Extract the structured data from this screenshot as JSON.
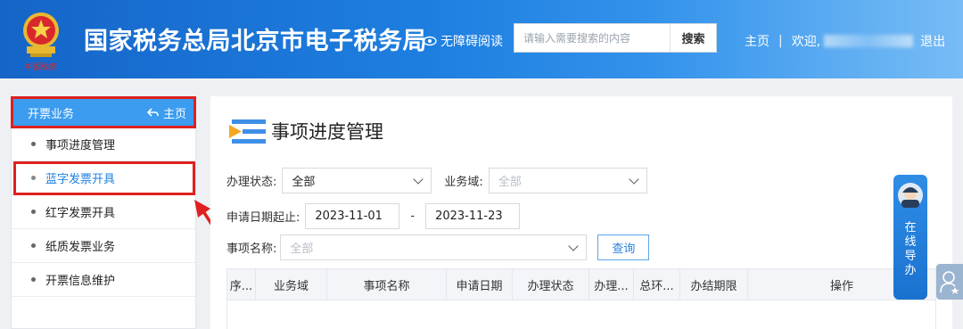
{
  "header": {
    "site_title": "国家税务总局北京市电子税务局",
    "accessible_reading": "无障碍阅读",
    "search_placeholder": "请输入需要搜索的内容",
    "search_button": "搜索",
    "home_link": "主页",
    "separator": "|",
    "welcome": "欢迎,",
    "logout": "退出"
  },
  "sidebar": {
    "section_title": "开票业务",
    "home_label": "主页",
    "items": [
      {
        "label": "事项进度管理"
      },
      {
        "label": "蓝字发票开具"
      },
      {
        "label": "红字发票开具"
      },
      {
        "label": "纸质发票业务"
      },
      {
        "label": "开票信息维护"
      }
    ],
    "active_index": 1
  },
  "main": {
    "page_title": "事项进度管理",
    "filters": {
      "status_label": "办理状态:",
      "status_value": "全部",
      "domain_label": "业务域:",
      "domain_placeholder": "全部",
      "date_label": "申请日期起止:",
      "date_start": "2023-11-01",
      "date_sep": "-",
      "date_end": "2023-11-23",
      "item_name_label": "事项名称:",
      "item_name_placeholder": "全部",
      "query_button": "查询"
    },
    "table": {
      "columns": [
        "序...",
        "业务域",
        "事项名称",
        "申请日期",
        "办理状态",
        "办理...",
        "总环...",
        "办结期限",
        "操作"
      ]
    }
  },
  "float_guide": {
    "label": "在线导办"
  },
  "colors": {
    "header_blue": "#1e7fe0",
    "sidebar_head": "#3b9cf0",
    "highlight_red": "#e02020",
    "active_link": "#1e7fe0"
  }
}
